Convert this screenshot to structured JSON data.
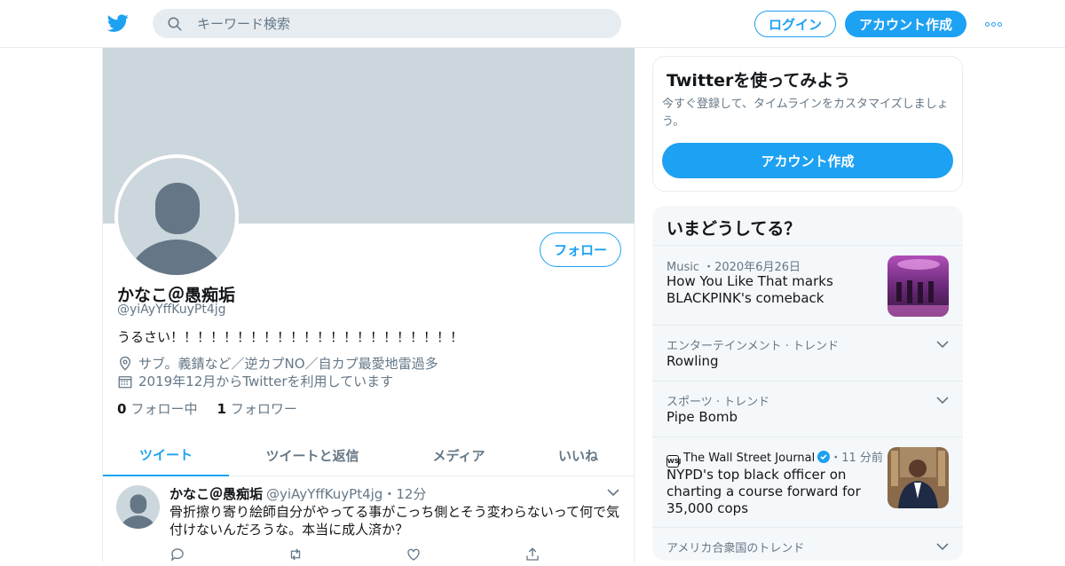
{
  "header": {
    "search_placeholder": "キーワード検索",
    "login_label": "ログイン",
    "signup_label": "アカウント作成",
    "brand_color": "#1da1f2"
  },
  "profile": {
    "name": "かなこ＠愚痴垢",
    "handle": "@yiAyYffKuyPt4jg",
    "follow_label": "フォロー",
    "bio": "うるさい！！！！！！！！！！！！！！！！！！！！！！",
    "location": "サブ。義錆など／逆カプNO／自カプ最愛地雷過多",
    "joined": "2019年12月からTwitterを利用しています",
    "following_count": "0",
    "following_label": "フォロー中",
    "followers_count": "1",
    "followers_label": "フォロワー"
  },
  "tabs": [
    {
      "label": "ツイート",
      "active": true
    },
    {
      "label": "ツイートと返信",
      "active": false
    },
    {
      "label": "メディア",
      "active": false
    },
    {
      "label": "いいね",
      "active": false
    }
  ],
  "tweet": {
    "name": "かなこ＠愚痴垢",
    "handle": "@yiAyYffKuyPt4jg",
    "sep": "・",
    "time": "12分",
    "text": "骨折擦り寄り絵師自分がやってる事がこっち側とそう変わらないって何で気付けないんだろうな。本当に成人済か？"
  },
  "signup_card": {
    "title": "Twitterを使ってみよう",
    "desc": "今すぐ登録して、タイムラインをカスタマイズしましょう。",
    "button": "アカウント作成"
  },
  "trends": {
    "title": "いまどうしてる？",
    "items": [
      {
        "meta": "Music ・2020年6月26日",
        "title": "How You Like That marks BLACKPINK's comeback",
        "image": "blackpink-photo"
      },
      {
        "meta": "エンターテインメント · トレンド",
        "title": "Rowling"
      },
      {
        "meta": "スポーツ · トレンド",
        "title": "Pipe Bomb"
      },
      {
        "source": "The Wall Street Journal",
        "time": "・11 分前",
        "title": "NYPD's top black officer on charting a course forward for 35,000 cops",
        "image": "officer-photo"
      },
      {
        "meta": "アメリカ合衆国のトレンド",
        "title": ""
      }
    ]
  }
}
